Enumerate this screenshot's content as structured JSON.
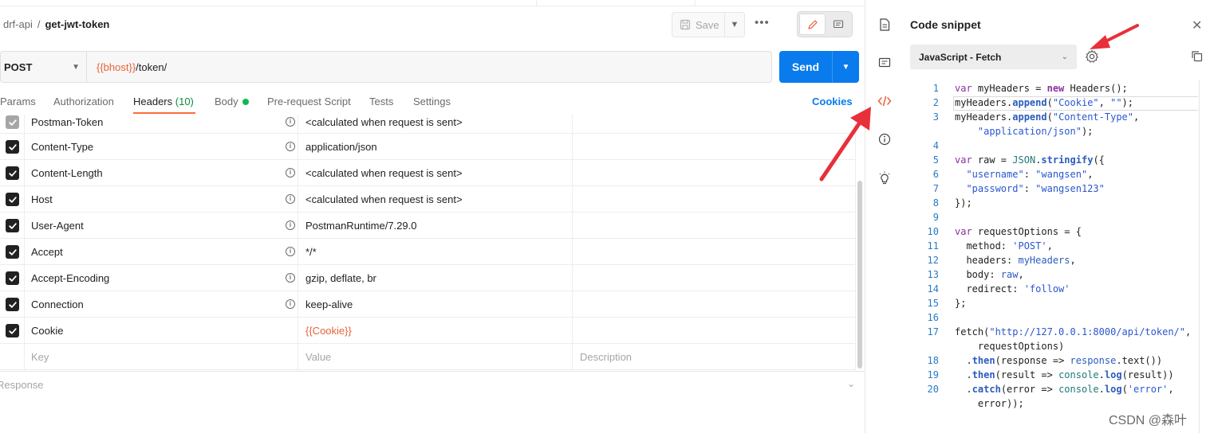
{
  "breadcrumb": {
    "collection": "drf-api",
    "separator": "/",
    "request": "get-jwt-token"
  },
  "toolbar": {
    "save_label": "Save",
    "more_label": "•••"
  },
  "request": {
    "method": "POST",
    "url_var": "{{bhost}}",
    "url_path": "/token/",
    "send_label": "Send"
  },
  "tabs": {
    "params": "Params",
    "authorization": "Authorization",
    "headers": "Headers",
    "headers_count": "(10)",
    "body": "Body",
    "prerequest": "Pre-request Script",
    "tests": "Tests",
    "settings": "Settings",
    "cookies": "Cookies"
  },
  "headers": [
    {
      "key": "Postman-Token",
      "value": "<calculated when request is sent>",
      "checked": true,
      "auto": true
    },
    {
      "key": "Content-Type",
      "value": "application/json",
      "checked": true
    },
    {
      "key": "Content-Length",
      "value": "<calculated when request is sent>",
      "checked": true
    },
    {
      "key": "Host",
      "value": "<calculated when request is sent>",
      "checked": true
    },
    {
      "key": "User-Agent",
      "value": "PostmanRuntime/7.29.0",
      "checked": true
    },
    {
      "key": "Accept",
      "value": "*/*",
      "checked": true
    },
    {
      "key": "Accept-Encoding",
      "value": "gzip, deflate, br",
      "checked": true
    },
    {
      "key": "Connection",
      "value": "keep-alive",
      "checked": true
    },
    {
      "key": "Cookie",
      "value": "{{Cookie}}",
      "checked": true
    }
  ],
  "placeholders": {
    "key": "Key",
    "value": "Value",
    "description": "Description"
  },
  "response": {
    "label": "Response"
  },
  "snippet": {
    "title": "Code snippet",
    "language": "JavaScript - Fetch",
    "lines": [
      {
        "n": "1",
        "html": "<span class='kw'>var</span> myHeaders = <span class='kwb'>new</span> Headers();"
      },
      {
        "n": "2",
        "html": "myHeaders.<span class='fn'>append</span>(<span class='st'>\"Cookie\"</span>, <span class='st'>\"\"</span>);"
      },
      {
        "n": "3",
        "html": "myHeaders.<span class='fn'>append</span>(<span class='st'>\"Content-Type\"</span>,"
      },
      {
        "n": "",
        "html": "    <span class='st'>\"application/json\"</span>);"
      },
      {
        "n": "4",
        "html": ""
      },
      {
        "n": "5",
        "html": "<span class='kw'>var</span> raw = <span class='cl'>JSON</span>.<span class='fn'>stringify</span>({"
      },
      {
        "n": "6",
        "html": "  <span class='st'>\"username\"</span>: <span class='st'>\"wangsen\"</span>,"
      },
      {
        "n": "7",
        "html": "  <span class='st'>\"password\"</span>: <span class='st'>\"wangsen123\"</span>"
      },
      {
        "n": "8",
        "html": "});"
      },
      {
        "n": "9",
        "html": ""
      },
      {
        "n": "10",
        "html": "<span class='kw'>var</span> requestOptions = {"
      },
      {
        "n": "11",
        "html": "  method: <span class='sq'>'POST'</span>,"
      },
      {
        "n": "12",
        "html": "  headers: <span class='ob'>myHeaders</span>,"
      },
      {
        "n": "13",
        "html": "  body: <span class='ob'>raw</span>,"
      },
      {
        "n": "14",
        "html": "  redirect: <span class='sq'>'follow'</span>"
      },
      {
        "n": "15",
        "html": "};"
      },
      {
        "n": "16",
        "html": ""
      },
      {
        "n": "17",
        "html": "fetch(<span class='st'>\"http://127.0.0.1:8000/api/token/\"</span>,"
      },
      {
        "n": "",
        "html": "    requestOptions)"
      },
      {
        "n": "18",
        "html": "  .<span class='fn'>then</span>(response =&gt; <span class='ob'>response</span>.text())"
      },
      {
        "n": "19",
        "html": "  .<span class='fn'>then</span>(result =&gt; <span class='cl'>console</span>.<span class='fn'>log</span>(result))"
      },
      {
        "n": "20",
        "html": "  .<span class='fn'>catch</span>(error =&gt; <span class='cl'>console</span>.<span class='fn'>log</span>(<span class='sq'>'error'</span>,"
      },
      {
        "n": "",
        "html": "    error));"
      }
    ]
  },
  "watermark": "CSDN @森叶",
  "colors": {
    "accent": "#ff6c37",
    "send": "#097bed",
    "variable": "#e8623a",
    "arrow": "#e8303a"
  }
}
